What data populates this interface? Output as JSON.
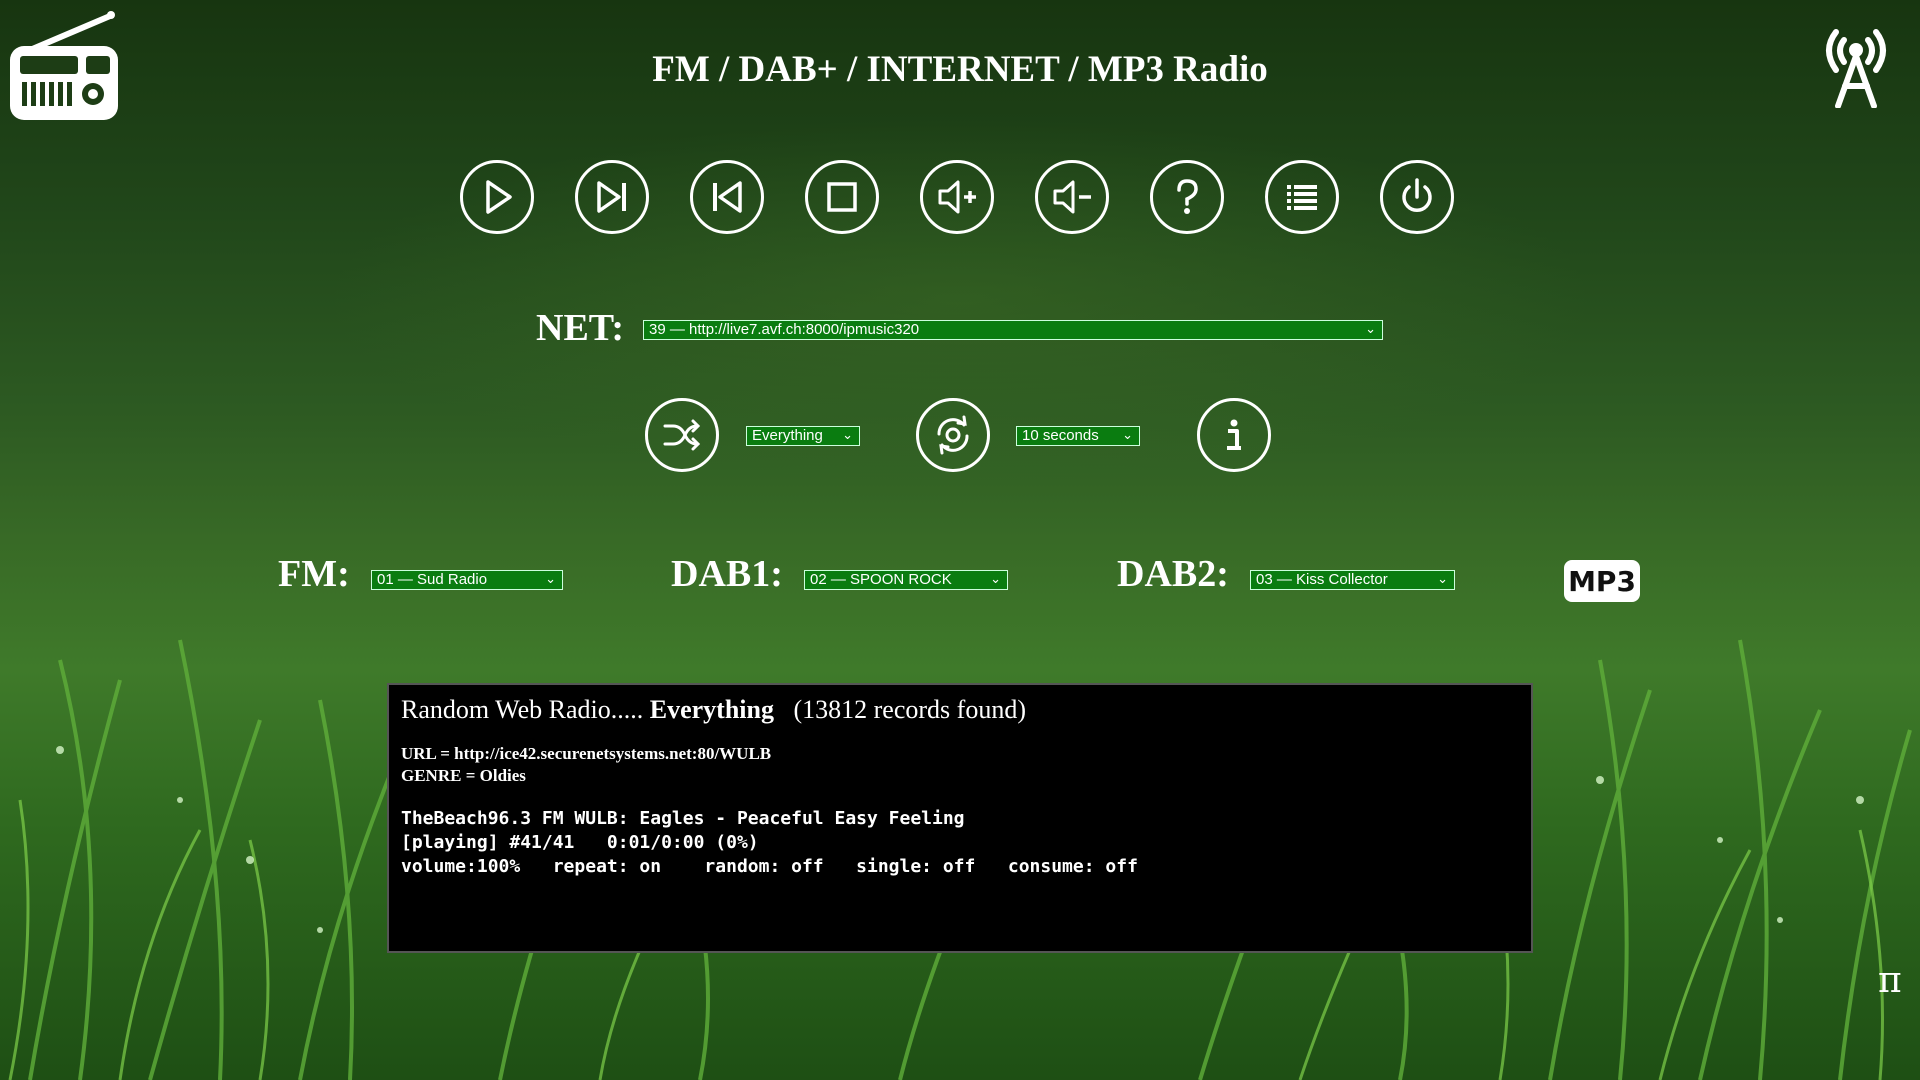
{
  "title": "FM / DAB+ / INTERNET / MP3 Radio",
  "controls": [
    {
      "name": "play-button",
      "icon": "play-icon"
    },
    {
      "name": "next-button",
      "icon": "skip-next-icon"
    },
    {
      "name": "previous-button",
      "icon": "skip-previous-icon"
    },
    {
      "name": "stop-button",
      "icon": "stop-icon"
    },
    {
      "name": "volume-up-button",
      "icon": "volume-up-icon"
    },
    {
      "name": "volume-down-button",
      "icon": "volume-down-icon"
    },
    {
      "name": "help-button",
      "icon": "help-icon"
    },
    {
      "name": "playlist-button",
      "icon": "list-icon"
    },
    {
      "name": "power-button",
      "icon": "power-icon"
    }
  ],
  "net": {
    "label": "NET:",
    "selected": "39 — http://live7.avf.ch:8000/ipmusic320"
  },
  "shuffle": {
    "icon": "shuffle-icon",
    "selected": "Everything"
  },
  "refresh": {
    "icon": "refresh-icon",
    "selected": "10 seconds"
  },
  "info_icon": "info-icon",
  "fm": {
    "label": "FM:",
    "selected": "01 — Sud Radio"
  },
  "dab1": {
    "label": "DAB1:",
    "selected": "02 — SPOON ROCK"
  },
  "dab2": {
    "label": "DAB2:",
    "selected": "03 — Kiss Collector"
  },
  "mp3_button": "MP3",
  "info": {
    "head_prefix": "Random Web Radio.....",
    "head_bold": "Everything",
    "head_suffix": "(13812 records found)",
    "url_line": "URL = http://ice42.securenetsystems.net:80/WULB",
    "genre_line": "GENRE = Oldies",
    "track_line": "TheBeach96.3 FM WULB: Eagles - Peaceful Easy Feeling",
    "status_line": "[playing] #41/41   0:01/0:00 (0%)",
    "state_line": "volume:100%   repeat: on    random: off   single: off   consume: off"
  },
  "pi_symbol": "π",
  "colors": {
    "select_bg": "#0a7c10",
    "text": "#ffffff",
    "panel_bg": "#000000"
  }
}
